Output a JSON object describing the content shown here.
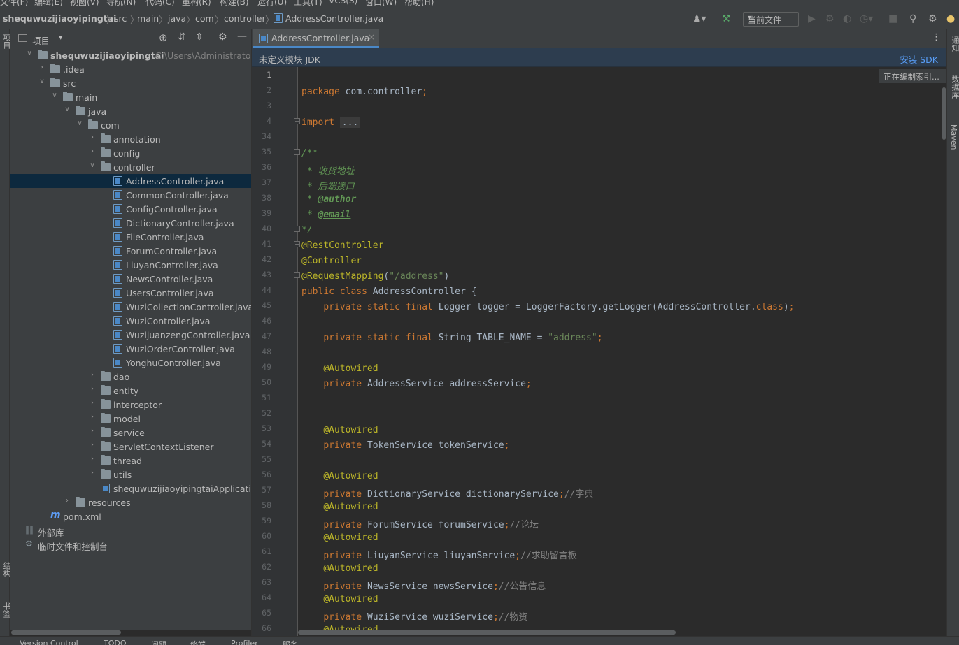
{
  "menu": [
    "文件(F)",
    "编辑(E)",
    "视图(V)",
    "导航(N)",
    "代码(C)",
    "重构(R)",
    "构建(B)",
    "运行(U)",
    "工具(T)",
    "VCS(S)",
    "窗口(W)",
    "帮助(H)"
  ],
  "breadcrumb": [
    "shequwuzijiaoyipingtai",
    "src",
    "main",
    "java",
    "com",
    "controller",
    "AddressController.java"
  ],
  "toolbar": {
    "run_config": "当前文件"
  },
  "project_panel": {
    "title": "项目",
    "root_name": "shequwuzijiaoyipingtai",
    "root_path": "C:\\Users\\Administrator\\De",
    "tree": [
      {
        "label": "shequwuzijiaoyipingtai",
        "level": 0,
        "kind": "module",
        "state": "open"
      },
      {
        "label": ".idea",
        "level": 1,
        "kind": "folder",
        "state": "closed"
      },
      {
        "label": "src",
        "level": 1,
        "kind": "folder",
        "state": "open"
      },
      {
        "label": "main",
        "level": 2,
        "kind": "folder",
        "state": "open"
      },
      {
        "label": "java",
        "level": 3,
        "kind": "folder",
        "state": "open"
      },
      {
        "label": "com",
        "level": 4,
        "kind": "folder",
        "state": "open"
      },
      {
        "label": "annotation",
        "level": 5,
        "kind": "folder",
        "state": "closed"
      },
      {
        "label": "config",
        "level": 5,
        "kind": "folder",
        "state": "closed"
      },
      {
        "label": "controller",
        "level": 5,
        "kind": "folder",
        "state": "open"
      },
      {
        "label": "AddressController.java",
        "level": 6,
        "kind": "java",
        "state": "none",
        "selected": true
      },
      {
        "label": "CommonController.java",
        "level": 6,
        "kind": "java",
        "state": "none"
      },
      {
        "label": "ConfigController.java",
        "level": 6,
        "kind": "java",
        "state": "none"
      },
      {
        "label": "DictionaryController.java",
        "level": 6,
        "kind": "java",
        "state": "none"
      },
      {
        "label": "FileController.java",
        "level": 6,
        "kind": "java",
        "state": "none"
      },
      {
        "label": "ForumController.java",
        "level": 6,
        "kind": "java",
        "state": "none"
      },
      {
        "label": "LiuyanController.java",
        "level": 6,
        "kind": "java",
        "state": "none"
      },
      {
        "label": "NewsController.java",
        "level": 6,
        "kind": "java",
        "state": "none"
      },
      {
        "label": "UsersController.java",
        "level": 6,
        "kind": "java",
        "state": "none"
      },
      {
        "label": "WuziCollectionController.java",
        "level": 6,
        "kind": "java",
        "state": "none"
      },
      {
        "label": "WuziController.java",
        "level": 6,
        "kind": "java",
        "state": "none"
      },
      {
        "label": "WuzijuanzengController.java",
        "level": 6,
        "kind": "java",
        "state": "none"
      },
      {
        "label": "WuziOrderController.java",
        "level": 6,
        "kind": "java",
        "state": "none"
      },
      {
        "label": "YonghuController.java",
        "level": 6,
        "kind": "java",
        "state": "none"
      },
      {
        "label": "dao",
        "level": 5,
        "kind": "folder",
        "state": "closed"
      },
      {
        "label": "entity",
        "level": 5,
        "kind": "folder",
        "state": "closed"
      },
      {
        "label": "interceptor",
        "level": 5,
        "kind": "folder",
        "state": "closed"
      },
      {
        "label": "model",
        "level": 5,
        "kind": "folder",
        "state": "closed"
      },
      {
        "label": "service",
        "level": 5,
        "kind": "folder",
        "state": "closed"
      },
      {
        "label": "ServletContextListener",
        "level": 5,
        "kind": "folder",
        "state": "closed"
      },
      {
        "label": "thread",
        "level": 5,
        "kind": "folder",
        "state": "closed"
      },
      {
        "label": "utils",
        "level": 5,
        "kind": "folder",
        "state": "closed"
      },
      {
        "label": "shequwuzijiaoyipingtaiApplication.jav",
        "level": 5,
        "kind": "java",
        "state": "none"
      },
      {
        "label": "resources",
        "level": 3,
        "kind": "folder",
        "state": "closed"
      },
      {
        "label": "pom.xml",
        "level": 1,
        "kind": "maven",
        "state": "none"
      },
      {
        "label": "外部库",
        "level": 0,
        "kind": "lib",
        "state": "none"
      },
      {
        "label": "临时文件和控制台",
        "level": 0,
        "kind": "scratch",
        "state": "none"
      }
    ]
  },
  "editor": {
    "tab_label": "AddressController.java",
    "banner_message": "未定义模块 JDK",
    "banner_action": "安装 SDK",
    "indexing_status": "正在编制索引...",
    "lines": [
      {
        "n": "1",
        "segs": []
      },
      {
        "n": "2",
        "segs": [
          [
            "kw",
            "package "
          ],
          [
            "p",
            "com.controller"
          ],
          [
            "kw",
            ";"
          ]
        ]
      },
      {
        "n": "3",
        "segs": []
      },
      {
        "n": "4",
        "segs": [
          [
            "kw",
            "import "
          ],
          [
            "f",
            "..."
          ]
        ]
      },
      {
        "n": "34",
        "segs": []
      },
      {
        "n": "35",
        "segs": [
          [
            "cm",
            "/**"
          ]
        ]
      },
      {
        "n": "36",
        "segs": [
          [
            "cm",
            " * 收货地址"
          ]
        ]
      },
      {
        "n": "37",
        "segs": [
          [
            "cm",
            " * 后端接口"
          ]
        ]
      },
      {
        "n": "38",
        "segs": [
          [
            "cm",
            " * "
          ],
          [
            "tag",
            "@author"
          ]
        ]
      },
      {
        "n": "39",
        "segs": [
          [
            "cm",
            " * "
          ],
          [
            "tag",
            "@email"
          ]
        ]
      },
      {
        "n": "40",
        "segs": [
          [
            "cm",
            "*/"
          ]
        ]
      },
      {
        "n": "41",
        "segs": [
          [
            "ann",
            "@RestController"
          ]
        ]
      },
      {
        "n": "42",
        "segs": [
          [
            "ann",
            "@Controller"
          ]
        ]
      },
      {
        "n": "43",
        "segs": [
          [
            "ann",
            "@RequestMapping"
          ],
          [
            "p",
            "("
          ],
          [
            "str",
            "\"/address\""
          ],
          [
            "p",
            ")"
          ]
        ]
      },
      {
        "n": "44",
        "segs": [
          [
            "kw",
            "public class "
          ],
          [
            "p",
            "AddressController {"
          ]
        ]
      },
      {
        "n": "45",
        "segs": [
          [
            "p",
            "    "
          ],
          [
            "kw",
            "private static final "
          ],
          [
            "p",
            "Logger "
          ],
          [
            "p",
            "logger = LoggerFactory."
          ],
          [
            "p",
            "getLogger"
          ],
          [
            "p",
            "(AddressController."
          ],
          [
            "kw",
            "class"
          ],
          [
            "p",
            ")"
          ],
          [
            "kw",
            ";"
          ]
        ]
      },
      {
        "n": "46",
        "segs": []
      },
      {
        "n": "47",
        "segs": [
          [
            "p",
            "    "
          ],
          [
            "kw",
            "private static final "
          ],
          [
            "p",
            "String "
          ],
          [
            "p",
            "TABLE_NAME = "
          ],
          [
            "str",
            "\"address\""
          ],
          [
            "kw",
            ";"
          ]
        ]
      },
      {
        "n": "48",
        "segs": []
      },
      {
        "n": "49",
        "segs": [
          [
            "p",
            "    "
          ],
          [
            "ann",
            "@Autowired"
          ]
        ]
      },
      {
        "n": "50",
        "segs": [
          [
            "p",
            "    "
          ],
          [
            "kw",
            "private "
          ],
          [
            "p",
            "AddressService addressService"
          ],
          [
            "kw",
            ";"
          ]
        ]
      },
      {
        "n": "51",
        "segs": []
      },
      {
        "n": "52",
        "segs": []
      },
      {
        "n": "53",
        "segs": [
          [
            "p",
            "    "
          ],
          [
            "ann",
            "@Autowired"
          ]
        ]
      },
      {
        "n": "54",
        "segs": [
          [
            "p",
            "    "
          ],
          [
            "kw",
            "private "
          ],
          [
            "p",
            "TokenService tokenService"
          ],
          [
            "kw",
            ";"
          ]
        ]
      },
      {
        "n": "55",
        "segs": []
      },
      {
        "n": "56",
        "segs": [
          [
            "p",
            "    "
          ],
          [
            "ann",
            "@Autowired"
          ]
        ]
      },
      {
        "n": "57",
        "segs": [
          [
            "p",
            "    "
          ],
          [
            "kw",
            "private "
          ],
          [
            "p",
            "DictionaryService dictionaryService"
          ],
          [
            "kw",
            ";"
          ],
          [
            "cmt",
            "//字典"
          ]
        ]
      },
      {
        "n": "58",
        "segs": [
          [
            "p",
            "    "
          ],
          [
            "ann",
            "@Autowired"
          ]
        ]
      },
      {
        "n": "59",
        "segs": [
          [
            "p",
            "    "
          ],
          [
            "kw",
            "private "
          ],
          [
            "p",
            "ForumService forumService"
          ],
          [
            "kw",
            ";"
          ],
          [
            "cmt",
            "//论坛"
          ]
        ]
      },
      {
        "n": "60",
        "segs": [
          [
            "p",
            "    "
          ],
          [
            "ann",
            "@Autowired"
          ]
        ]
      },
      {
        "n": "61",
        "segs": [
          [
            "p",
            "    "
          ],
          [
            "kw",
            "private "
          ],
          [
            "p",
            "LiuyanService liuyanService"
          ],
          [
            "kw",
            ";"
          ],
          [
            "cmt",
            "//求助留言板"
          ]
        ]
      },
      {
        "n": "62",
        "segs": [
          [
            "p",
            "    "
          ],
          [
            "ann",
            "@Autowired"
          ]
        ]
      },
      {
        "n": "63",
        "segs": [
          [
            "p",
            "    "
          ],
          [
            "kw",
            "private "
          ],
          [
            "p",
            "NewsService newsService"
          ],
          [
            "kw",
            ";"
          ],
          [
            "cmt",
            "//公告信息"
          ]
        ]
      },
      {
        "n": "64",
        "segs": [
          [
            "p",
            "    "
          ],
          [
            "ann",
            "@Autowired"
          ]
        ]
      },
      {
        "n": "65",
        "segs": [
          [
            "p",
            "    "
          ],
          [
            "kw",
            "private "
          ],
          [
            "p",
            "WuziService wuziService"
          ],
          [
            "kw",
            ";"
          ],
          [
            "cmt",
            "//物资"
          ]
        ]
      },
      {
        "n": "66",
        "segs": [
          [
            "p",
            "    "
          ],
          [
            "ann",
            "@Autowired"
          ]
        ]
      }
    ]
  },
  "left_strip": {
    "project": "项目",
    "structure": "结构",
    "bookmarks": "书签"
  },
  "right_strip": {
    "notifications": "通知",
    "database": "数据库",
    "maven": "Maven"
  },
  "bottom_bar": [
    "Version Control",
    "TODO",
    "问题",
    "终端",
    "Profiler",
    "服务"
  ]
}
